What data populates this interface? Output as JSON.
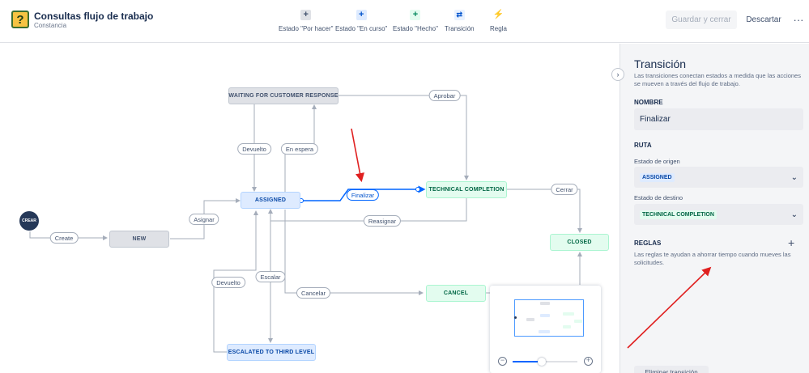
{
  "header": {
    "title": "Consultas flujo de trabajo",
    "subtitle": "Constancia",
    "icon_glyph": "?",
    "tools": [
      {
        "label": "Estado \"Por hacer\"",
        "glyph": "+",
        "bg": "#dfe1e6",
        "fg": "#42526e"
      },
      {
        "label": "Estado \"En curso\"",
        "glyph": "+",
        "bg": "#deebff",
        "fg": "#0052cc"
      },
      {
        "label": "Estado \"Hecho\"",
        "glyph": "+",
        "bg": "#e3fcef",
        "fg": "#00875a"
      },
      {
        "label": "Transición",
        "glyph": "⇄",
        "bg": "#e9f2ff",
        "fg": "#0052cc"
      },
      {
        "label": "Regla",
        "glyph": "⚡",
        "bg": "transparent",
        "fg": "#42526e"
      }
    ],
    "save_label": "Guardar y cerrar",
    "discard_label": "Descartar",
    "more_label": "···"
  },
  "workflow": {
    "start_label": "CREAR",
    "statuses": {
      "waiting": "WAITING FOR CUSTOMER RESPONSE",
      "assigned": "ASSIGNED",
      "technical": "TECHNICAL COMPLETION",
      "new": "NEW",
      "closed": "CLOSED",
      "cancel": "CANCEL",
      "escalated": "ESCALATED TO THIRD LEVEL"
    },
    "transitions": {
      "aprobar": "Aprobar",
      "devuelto_top": "Devuelto",
      "en_espera": "En espera",
      "finalizar": "Finalizar",
      "cerrar": "Cerrar",
      "asignar": "Asignar",
      "create": "Create",
      "reasignar": "Reasignar",
      "escalar": "Escalar",
      "devuelto_bottom": "Devuelto",
      "cancelar": "Cancelar"
    }
  },
  "minimap": {
    "zoom_out_glyph": "−",
    "zoom_in_glyph": "+",
    "zoom_level": 0.45
  },
  "panel": {
    "collapse_glyph": "›",
    "title": "Transición",
    "description": "Las transiciones conectan estados a medida que las acciones se mueven a través del flujo de trabajo.",
    "name_label": "NOMBRE",
    "name_value": "Finalizar",
    "route_label": "RUTA",
    "origin_label": "Estado de origen",
    "origin_value": "ASSIGNED",
    "dest_label": "Estado de destino",
    "dest_value": "TECHNICAL COMPLETION",
    "chevron_glyph": "⌄",
    "rules_label": "REGLAS",
    "rules_add_glyph": "+",
    "rules_desc": "Las reglas te ayudan a ahorrar tiempo cuando mueves las solicitudes.",
    "delete_label": "Eliminar transición"
  },
  "colors": {
    "selected_edge": "#0065ff",
    "edge": "#a5adba",
    "annotation_arrow": "#e02020"
  }
}
